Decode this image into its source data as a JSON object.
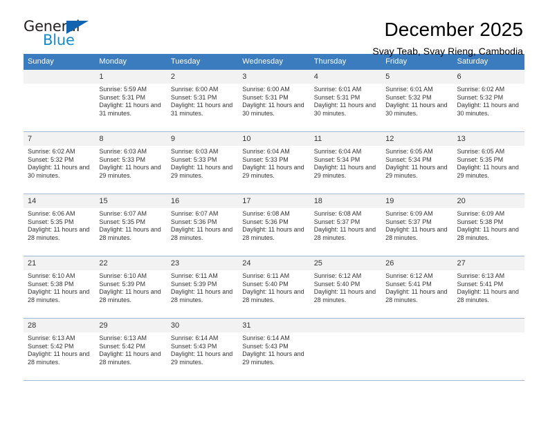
{
  "brand": {
    "name_primary": "General",
    "name_secondary": "Blue",
    "primary_color": "#231f20",
    "secondary_color": "#1689ca",
    "triangle_color": "#1263b0"
  },
  "header": {
    "title": "December 2025",
    "subtitle": "Svay Teab, Svay Rieng, Cambodia"
  },
  "calendar": {
    "header_bg": "#3b7cbe",
    "daynum_bg": "#f2f2f2",
    "grid_line_color": "#9fb9d4",
    "weekdays": [
      "Sunday",
      "Monday",
      "Tuesday",
      "Wednesday",
      "Thursday",
      "Friday",
      "Saturday"
    ],
    "weeks": [
      [
        {
          "day": "",
          "sunrise": "",
          "sunset": "",
          "daylight": "",
          "empty": true
        },
        {
          "day": "1",
          "sunrise": "Sunrise: 5:59 AM",
          "sunset": "Sunset: 5:31 PM",
          "daylight": "Daylight: 11 hours and 31 minutes.",
          "empty": false
        },
        {
          "day": "2",
          "sunrise": "Sunrise: 6:00 AM",
          "sunset": "Sunset: 5:31 PM",
          "daylight": "Daylight: 11 hours and 31 minutes.",
          "empty": false
        },
        {
          "day": "3",
          "sunrise": "Sunrise: 6:00 AM",
          "sunset": "Sunset: 5:31 PM",
          "daylight": "Daylight: 11 hours and 30 minutes.",
          "empty": false
        },
        {
          "day": "4",
          "sunrise": "Sunrise: 6:01 AM",
          "sunset": "Sunset: 5:31 PM",
          "daylight": "Daylight: 11 hours and 30 minutes.",
          "empty": false
        },
        {
          "day": "5",
          "sunrise": "Sunrise: 6:01 AM",
          "sunset": "Sunset: 5:32 PM",
          "daylight": "Daylight: 11 hours and 30 minutes.",
          "empty": false
        },
        {
          "day": "6",
          "sunrise": "Sunrise: 6:02 AM",
          "sunset": "Sunset: 5:32 PM",
          "daylight": "Daylight: 11 hours and 30 minutes.",
          "empty": false
        }
      ],
      [
        {
          "day": "7",
          "sunrise": "Sunrise: 6:02 AM",
          "sunset": "Sunset: 5:32 PM",
          "daylight": "Daylight: 11 hours and 30 minutes.",
          "empty": false
        },
        {
          "day": "8",
          "sunrise": "Sunrise: 6:03 AM",
          "sunset": "Sunset: 5:33 PM",
          "daylight": "Daylight: 11 hours and 29 minutes.",
          "empty": false
        },
        {
          "day": "9",
          "sunrise": "Sunrise: 6:03 AM",
          "sunset": "Sunset: 5:33 PM",
          "daylight": "Daylight: 11 hours and 29 minutes.",
          "empty": false
        },
        {
          "day": "10",
          "sunrise": "Sunrise: 6:04 AM",
          "sunset": "Sunset: 5:33 PM",
          "daylight": "Daylight: 11 hours and 29 minutes.",
          "empty": false
        },
        {
          "day": "11",
          "sunrise": "Sunrise: 6:04 AM",
          "sunset": "Sunset: 5:34 PM",
          "daylight": "Daylight: 11 hours and 29 minutes.",
          "empty": false
        },
        {
          "day": "12",
          "sunrise": "Sunrise: 6:05 AM",
          "sunset": "Sunset: 5:34 PM",
          "daylight": "Daylight: 11 hours and 29 minutes.",
          "empty": false
        },
        {
          "day": "13",
          "sunrise": "Sunrise: 6:05 AM",
          "sunset": "Sunset: 5:35 PM",
          "daylight": "Daylight: 11 hours and 29 minutes.",
          "empty": false
        }
      ],
      [
        {
          "day": "14",
          "sunrise": "Sunrise: 6:06 AM",
          "sunset": "Sunset: 5:35 PM",
          "daylight": "Daylight: 11 hours and 28 minutes.",
          "empty": false
        },
        {
          "day": "15",
          "sunrise": "Sunrise: 6:07 AM",
          "sunset": "Sunset: 5:35 PM",
          "daylight": "Daylight: 11 hours and 28 minutes.",
          "empty": false
        },
        {
          "day": "16",
          "sunrise": "Sunrise: 6:07 AM",
          "sunset": "Sunset: 5:36 PM",
          "daylight": "Daylight: 11 hours and 28 minutes.",
          "empty": false
        },
        {
          "day": "17",
          "sunrise": "Sunrise: 6:08 AM",
          "sunset": "Sunset: 5:36 PM",
          "daylight": "Daylight: 11 hours and 28 minutes.",
          "empty": false
        },
        {
          "day": "18",
          "sunrise": "Sunrise: 6:08 AM",
          "sunset": "Sunset: 5:37 PM",
          "daylight": "Daylight: 11 hours and 28 minutes.",
          "empty": false
        },
        {
          "day": "19",
          "sunrise": "Sunrise: 6:09 AM",
          "sunset": "Sunset: 5:37 PM",
          "daylight": "Daylight: 11 hours and 28 minutes.",
          "empty": false
        },
        {
          "day": "20",
          "sunrise": "Sunrise: 6:09 AM",
          "sunset": "Sunset: 5:38 PM",
          "daylight": "Daylight: 11 hours and 28 minutes.",
          "empty": false
        }
      ],
      [
        {
          "day": "21",
          "sunrise": "Sunrise: 6:10 AM",
          "sunset": "Sunset: 5:38 PM",
          "daylight": "Daylight: 11 hours and 28 minutes.",
          "empty": false
        },
        {
          "day": "22",
          "sunrise": "Sunrise: 6:10 AM",
          "sunset": "Sunset: 5:39 PM",
          "daylight": "Daylight: 11 hours and 28 minutes.",
          "empty": false
        },
        {
          "day": "23",
          "sunrise": "Sunrise: 6:11 AM",
          "sunset": "Sunset: 5:39 PM",
          "daylight": "Daylight: 11 hours and 28 minutes.",
          "empty": false
        },
        {
          "day": "24",
          "sunrise": "Sunrise: 6:11 AM",
          "sunset": "Sunset: 5:40 PM",
          "daylight": "Daylight: 11 hours and 28 minutes.",
          "empty": false
        },
        {
          "day": "25",
          "sunrise": "Sunrise: 6:12 AM",
          "sunset": "Sunset: 5:40 PM",
          "daylight": "Daylight: 11 hours and 28 minutes.",
          "empty": false
        },
        {
          "day": "26",
          "sunrise": "Sunrise: 6:12 AM",
          "sunset": "Sunset: 5:41 PM",
          "daylight": "Daylight: 11 hours and 28 minutes.",
          "empty": false
        },
        {
          "day": "27",
          "sunrise": "Sunrise: 6:13 AM",
          "sunset": "Sunset: 5:41 PM",
          "daylight": "Daylight: 11 hours and 28 minutes.",
          "empty": false
        }
      ],
      [
        {
          "day": "28",
          "sunrise": "Sunrise: 6:13 AM",
          "sunset": "Sunset: 5:42 PM",
          "daylight": "Daylight: 11 hours and 28 minutes.",
          "empty": false
        },
        {
          "day": "29",
          "sunrise": "Sunrise: 6:13 AM",
          "sunset": "Sunset: 5:42 PM",
          "daylight": "Daylight: 11 hours and 28 minutes.",
          "empty": false
        },
        {
          "day": "30",
          "sunrise": "Sunrise: 6:14 AM",
          "sunset": "Sunset: 5:43 PM",
          "daylight": "Daylight: 11 hours and 29 minutes.",
          "empty": false
        },
        {
          "day": "31",
          "sunrise": "Sunrise: 6:14 AM",
          "sunset": "Sunset: 5:43 PM",
          "daylight": "Daylight: 11 hours and 29 minutes.",
          "empty": false
        },
        {
          "day": "",
          "sunrise": "",
          "sunset": "",
          "daylight": "",
          "empty": true
        },
        {
          "day": "",
          "sunrise": "",
          "sunset": "",
          "daylight": "",
          "empty": true
        },
        {
          "day": "",
          "sunrise": "",
          "sunset": "",
          "daylight": "",
          "empty": true
        }
      ]
    ]
  }
}
